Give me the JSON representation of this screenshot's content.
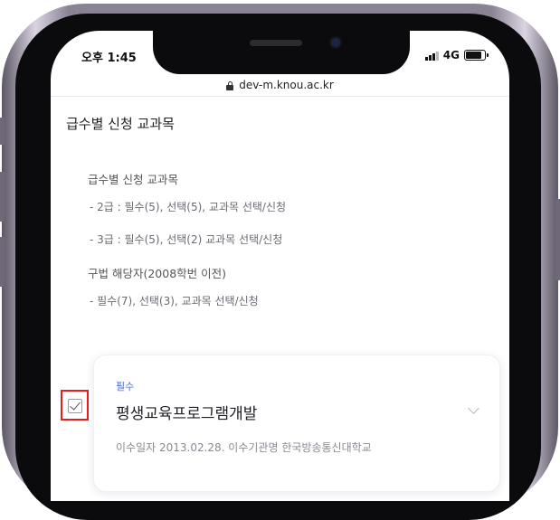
{
  "status_bar": {
    "time": "오후 1:45",
    "network": "4G",
    "icons": [
      "signal-icon",
      "battery-icon"
    ]
  },
  "browser": {
    "url": "dev-m.knou.ac.kr",
    "icon": "lock-icon"
  },
  "page": {
    "section_title": "급수별 신청 교과목",
    "info": {
      "heading": "급수별 신청 교과목",
      "grade2": "- 2급 : 필수(5), 선택(5), 교과목 선택/신청",
      "grade3": "- 3급 : 필수(5), 선택(2) 교과목 선택/신청",
      "old_heading": "구법 해당자(2008학번 이전)",
      "old_rule": "- 필수(7), 선택(3), 교과목 선택/신청"
    }
  },
  "course_card": {
    "badge": "필수",
    "title": "평생교육프로그램개발",
    "meta": "이수일자 2013.02.28.   이수기관명 한국방송통신대학교",
    "checked": true,
    "icon": "chevron-down-icon"
  },
  "colors": {
    "accent": "#4a6ccf",
    "highlight": "#e11f1f",
    "frame": "#8a8394"
  }
}
